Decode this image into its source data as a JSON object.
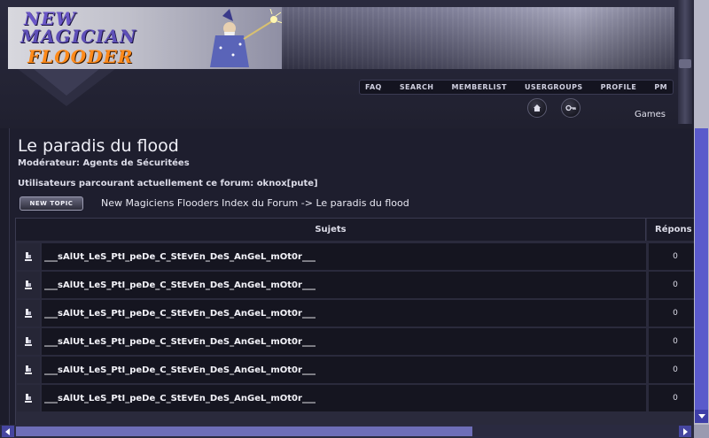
{
  "header": {
    "logo_line1": "NEW",
    "logo_line2": "MAGICIAN",
    "logo_line3": "FLOODER",
    "nav": [
      "FAQ",
      "SEARCH",
      "MEMBERLIST",
      "USERGROUPS",
      "PROFILE",
      "PM"
    ],
    "games_label": "Games",
    "round_buttons": [
      "home-icon",
      "key-icon"
    ]
  },
  "forum": {
    "title": "Le paradis du flood",
    "moderator": "Modérateur: Agents de Sécuritées",
    "viewers": "Utilisateurs parcourant actuellement ce forum: oknox[pute]",
    "new_topic_label": "NEW TOPIC",
    "breadcrumb_index": "New Magiciens Flooders Index du Forum",
    "breadcrumb_sep": "->",
    "breadcrumb_current": "Le paradis du flood"
  },
  "table": {
    "headers": {
      "subjects": "Sujets",
      "replies": "Répons"
    },
    "rows": [
      {
        "title": "___sAlUt_LeS_PtI_peDe_C_StEvEn_DeS_AnGeL_mOt0r___",
        "replies": "0"
      },
      {
        "title": "___sAlUt_LeS_PtI_peDe_C_StEvEn_DeS_AnGeL_mOt0r___",
        "replies": "0"
      },
      {
        "title": "___sAlUt_LeS_PtI_peDe_C_StEvEn_DeS_AnGeL_mOt0r___",
        "replies": "0"
      },
      {
        "title": "___sAlUt_LeS_PtI_peDe_C_StEvEn_DeS_AnGeL_mOt0r___",
        "replies": "0"
      },
      {
        "title": "___sAlUt_LeS_PtI_peDe_C_StEvEn_DeS_AnGeL_mOt0r___",
        "replies": "0"
      },
      {
        "title": "___sAlUt_LeS_PtI_peDe_C_StEvEn_DeS_AnGeL_mOt0r___",
        "replies": "0"
      }
    ]
  },
  "colors": {
    "background": "#1c1c2b",
    "scrollbar_thumb": "#5a5acb",
    "logo_orange": "#ff8a1a",
    "logo_purple": "#6a56c8"
  }
}
